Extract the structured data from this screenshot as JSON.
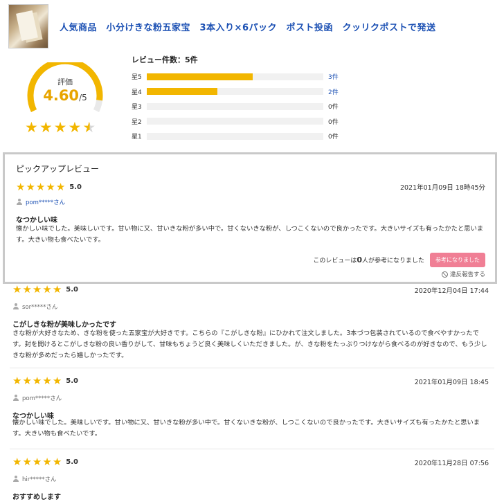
{
  "header": {
    "title": "人気商品　小分けきな粉五家宝　3本入り×6パック　ポスト投函　クッリクポストで発送"
  },
  "summary": {
    "label": "評価",
    "score": "4.60",
    "max": "/5",
    "score_fraction": 0.92,
    "accent_color": "#f2b600",
    "review_count_label": "レビュー件数：5件",
    "distribution": [
      {
        "label": "星5",
        "count": "3件",
        "fraction": 0.6,
        "link": true
      },
      {
        "label": "星4",
        "count": "2件",
        "fraction": 0.4,
        "link": true
      },
      {
        "label": "星3",
        "count": "0件",
        "fraction": 0,
        "link": false
      },
      {
        "label": "星2",
        "count": "0件",
        "fraction": 0,
        "link": false
      },
      {
        "label": "星1",
        "count": "0件",
        "fraction": 0,
        "link": false
      }
    ]
  },
  "pickup": {
    "heading": "ピックアップレビュー",
    "review": {
      "score": "5.0",
      "date": "2021年01月09日 18時45分",
      "user": "pom*****さん",
      "title": "なつかしい味",
      "body": "懐かしい味でした。美味しいです。甘い物に又、甘いきな粉が多い中で。甘くないきな粉が、しつこくないので良かったです。大きいサイズも有ったかたと思います。大きい物も食べたいです。"
    },
    "helpful_prefix": "このレビューは",
    "helpful_count": "0",
    "helpful_suffix": "人が参考になりました",
    "helpful_button": "参考になりました",
    "report_label": "違反報告する"
  },
  "reviews": [
    {
      "score": "5.0",
      "date": "2020年12月04日 17:44",
      "user": "sor*****さん",
      "title": "こがしきな粉が美味しかったです",
      "body": "きな粉が大好きなため、きな粉を使った五家宝が大好きです。こちらの『こがしきな粉』にひかれて注文しました。3本づつ包装されているので食べやすかったです。封を開けるとこがしきな粉の良い香りがして、甘味もちょうど良く美味しくいただきました。が、きな粉をたっぷりつけながら食べるのが好きなので、もう少しきな粉が多めだったら嬉しかったです。"
    },
    {
      "score": "5.0",
      "date": "2021年01月09日 18:45",
      "user": "pom*****さん",
      "title": "なつかしい味",
      "body": "懐かしい味でした。美味しいです。甘い物に又、甘いきな粉が多い中で。甘くないきな粉が、しつこくないので良かったです。大きいサイズも有ったかたと思います。大きい物も食べたいです。"
    },
    {
      "score": "5.0",
      "date": "2020年11月28日 07:56",
      "user": "hir*****さん",
      "title": "おすすめします"
    }
  ],
  "icons": {
    "star": "star-icon",
    "user": "user-icon",
    "report": "ban-icon"
  }
}
